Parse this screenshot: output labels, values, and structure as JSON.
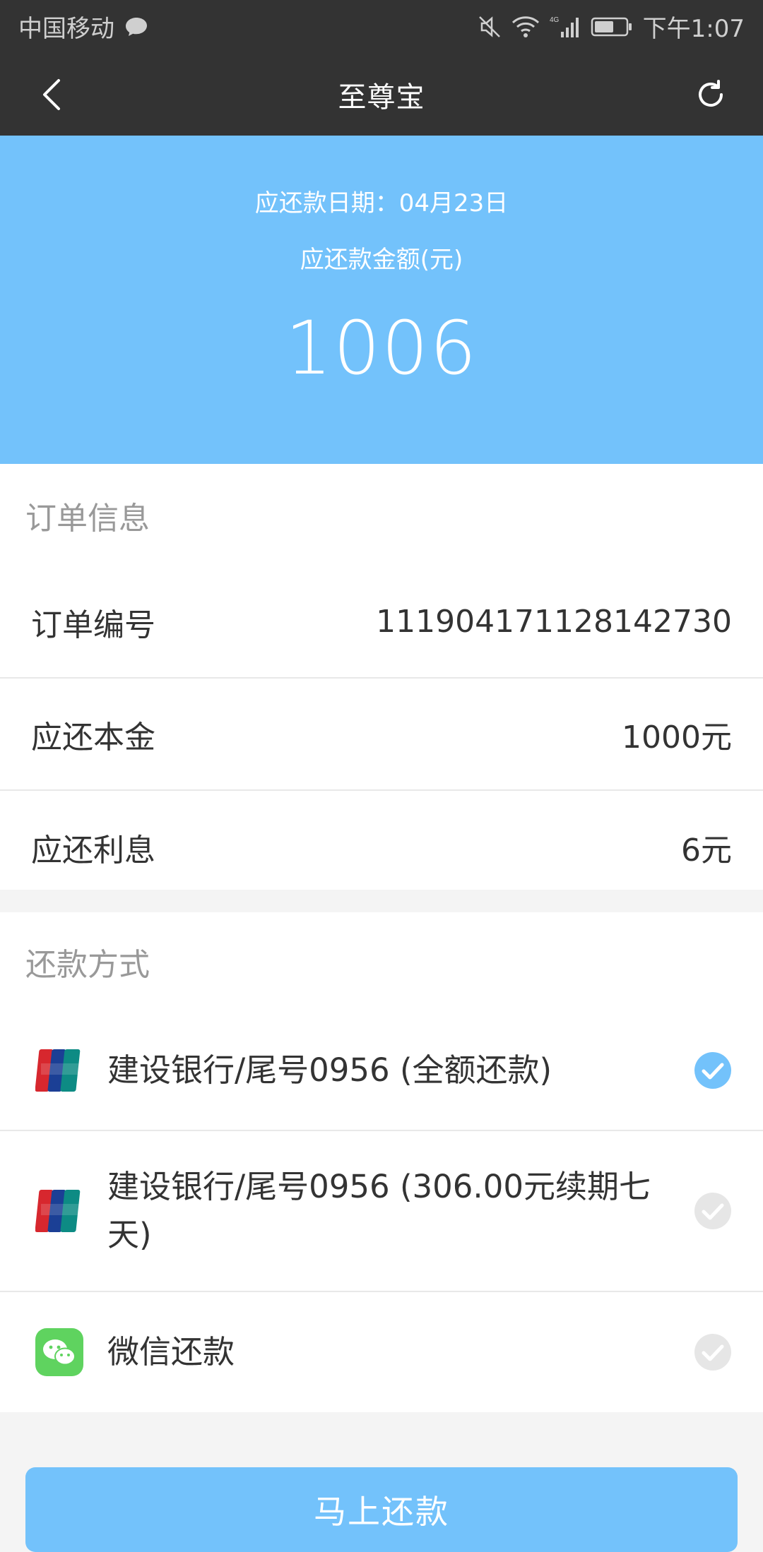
{
  "status_bar": {
    "carrier": "中国移动",
    "network": "4G",
    "time": "下午1:07"
  },
  "header": {
    "title": "至尊宝"
  },
  "hero": {
    "due_date": "应还款日期：04月23日",
    "amount_label": "应还款金额(元)",
    "amount": "1006"
  },
  "order": {
    "section_title": "订单信息",
    "rows": [
      {
        "label": "订单编号",
        "value": "111904171128142730"
      },
      {
        "label": "应还本金",
        "value": "1000元"
      },
      {
        "label": "应还利息",
        "value": "6元"
      }
    ]
  },
  "payment": {
    "section_title": "还款方式",
    "methods": [
      {
        "label": "建设银行/尾号0956 (全额还款)",
        "icon": "unionpay-icon",
        "selected": true
      },
      {
        "label": "建设银行/尾号0956 (306.00元续期七天)",
        "icon": "unionpay-icon",
        "selected": false
      },
      {
        "label": "微信还款",
        "icon": "wechat-icon",
        "selected": false
      }
    ]
  },
  "action": {
    "pay_now_label": "马上还款"
  },
  "colors": {
    "primary": "#73c2fb",
    "header_bg": "#333333",
    "check_inactive": "#e6e6e6"
  }
}
